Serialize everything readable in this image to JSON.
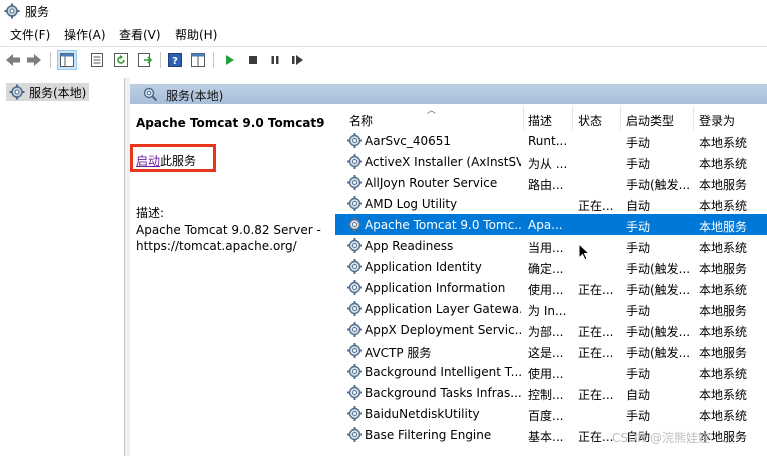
{
  "window": {
    "title": "服务"
  },
  "menu": [
    "文件(F)",
    "操作(A)",
    "查看(V)",
    "帮助(H)"
  ],
  "toolbar": {
    "icons": [
      "back-arrow-icon",
      "forward-arrow-icon",
      "console-tree-icon",
      "properties-icon",
      "refresh-icon",
      "export-list-icon",
      "help-icon",
      "view-icon",
      "play-icon",
      "stop-icon",
      "pause-icon",
      "restart-icon"
    ]
  },
  "tree": {
    "root_label": "服务(本地)"
  },
  "panel": {
    "header": "服务(本地)",
    "selected_service": "Apache Tomcat 9.0 Tomcat9",
    "action_link": "启动",
    "action_suffix": "此服务",
    "description_label": "描述:",
    "description_text": "Apache Tomcat 9.0.82 Server - https://tomcat.apache.org/"
  },
  "columns": {
    "name": "名称",
    "description": "描述",
    "status": "状态",
    "startup": "启动类型",
    "logon": "登录为"
  },
  "services": [
    {
      "name": "AarSvc_40651",
      "desc": "Runt...",
      "status": "",
      "startup": "手动",
      "logon": "本地系统"
    },
    {
      "name": "ActiveX Installer (AxInstSV)",
      "desc": "为从 ...",
      "status": "",
      "startup": "手动",
      "logon": "本地系统"
    },
    {
      "name": "AllJoyn Router Service",
      "desc": "路由...",
      "status": "",
      "startup": "手动(触发...",
      "logon": "本地服务"
    },
    {
      "name": "AMD Log Utility",
      "desc": "",
      "status": "正在...",
      "startup": "自动",
      "logon": "本地系统"
    },
    {
      "name": "Apache Tomcat 9.0 Tomc...",
      "desc": "Apa...",
      "status": "",
      "startup": "手动",
      "logon": "本地服务",
      "selected": true
    },
    {
      "name": "App Readiness",
      "desc": "当用...",
      "status": "",
      "startup": "手动",
      "logon": "本地系统"
    },
    {
      "name": "Application Identity",
      "desc": "确定...",
      "status": "",
      "startup": "手动(触发...",
      "logon": "本地服务"
    },
    {
      "name": "Application Information",
      "desc": "使用...",
      "status": "正在...",
      "startup": "手动(触发...",
      "logon": "本地系统"
    },
    {
      "name": "Application Layer Gatewa...",
      "desc": "为 In...",
      "status": "",
      "startup": "手动",
      "logon": "本地服务"
    },
    {
      "name": "AppX Deployment Servic...",
      "desc": "为部...",
      "status": "正在...",
      "startup": "手动(触发...",
      "logon": "本地系统"
    },
    {
      "name": "AVCTP 服务",
      "desc": "这是...",
      "status": "正在...",
      "startup": "手动(触发...",
      "logon": "本地服务"
    },
    {
      "name": "Background Intelligent T...",
      "desc": "使用...",
      "status": "",
      "startup": "手动",
      "logon": "本地系统"
    },
    {
      "name": "Background Tasks Infras...",
      "desc": "控制...",
      "status": "正在...",
      "startup": "自动",
      "logon": "本地系统"
    },
    {
      "name": "BaiduNetdiskUtility",
      "desc": "百度...",
      "status": "",
      "startup": "手动",
      "logon": "本地系统"
    },
    {
      "name": "Base Filtering Engine",
      "desc": "基本...",
      "status": "正在...",
      "startup": "自动",
      "logon": "本地服务"
    }
  ],
  "watermark": "CSDN @浣熊娃娃",
  "colors": {
    "selection": "#0078d7",
    "header_band": "#b4c8e0",
    "link": "#6f1f9f",
    "highlight_box": "#e8351c"
  }
}
